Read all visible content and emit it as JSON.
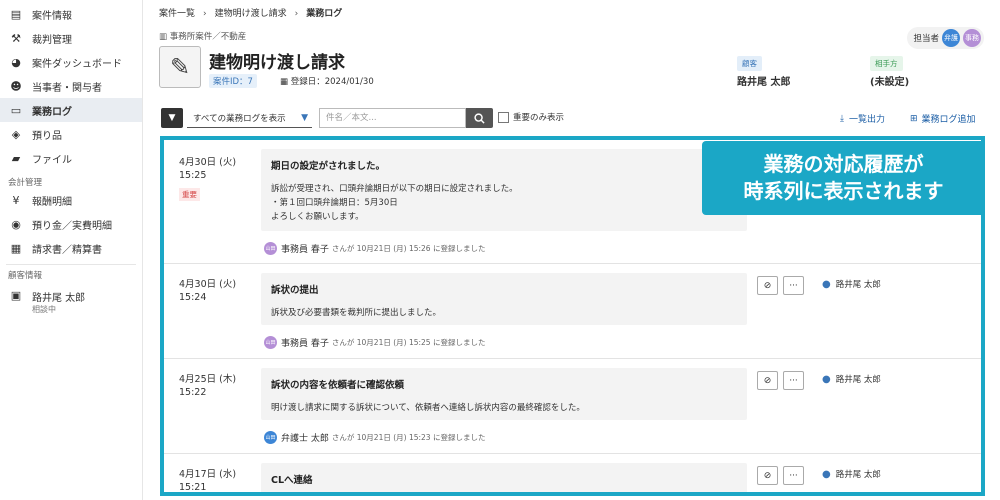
{
  "sidebar": {
    "items": [
      {
        "label": "案件情報",
        "icon": "document-icon"
      },
      {
        "label": "裁判管理",
        "icon": "gavel-icon"
      },
      {
        "label": "案件ダッシュボード",
        "icon": "dashboard-icon"
      },
      {
        "label": "当事者・関与者",
        "icon": "people-icon"
      },
      {
        "label": "業務ログ",
        "icon": "log-icon",
        "active": true
      },
      {
        "label": "預り品",
        "icon": "box-icon"
      },
      {
        "label": "ファイル",
        "icon": "folder-icon"
      }
    ],
    "section_accounting": "会計管理",
    "accounting_items": [
      {
        "label": "報酬明細",
        "icon": "yen-icon"
      },
      {
        "label": "預り金／実費明細",
        "icon": "coins-icon"
      },
      {
        "label": "請求書／精算書",
        "icon": "invoice-icon"
      }
    ],
    "section_client": "顧客情報",
    "client": {
      "name": "路井尾 太郎",
      "status": "相談中"
    }
  },
  "breadcrumb": {
    "items": [
      "案件一覧",
      "建物明け渡し請求"
    ],
    "current": "業務ログ"
  },
  "case": {
    "category": "事務所案件／不動産",
    "title": "建物明け渡し請求",
    "id_label": "案件ID：7",
    "registered": "登録日：2024/01/30",
    "assignee_label": "担当者",
    "assignee_avatars": [
      "弁護",
      "事務"
    ],
    "client_label": "顧客",
    "client_value": "路井尾 太郎",
    "opponent_label": "相手方",
    "opponent_value": "(未設定)"
  },
  "toolbar": {
    "filter_value": "すべての業務ログを表示",
    "search_placeholder": "件名／本文...",
    "important_only": "重要のみ表示",
    "export_label": "一覧出力",
    "add_label": "業務ログ追加"
  },
  "logs": [
    {
      "date": "4月30日 (火)",
      "time": "15:25",
      "badge": "重要",
      "title": "期日の設定がされました。",
      "lines": [
        "訴訟が受理され、口頭弁論期日が以下の期日に設定されました。",
        "・第１回口頭弁論期日：5月30日",
        "よろしくお願いします。"
      ],
      "by": "事務員 春子",
      "by_avatar": "山田",
      "suffix": "さんが 10月21日 (月) 15:26 に登録しました",
      "person": ""
    },
    {
      "date": "4月30日 (火)",
      "time": "15:24",
      "title": "訴状の提出",
      "lines": [
        "訴状及び必要書類を裁判所に提出しました。"
      ],
      "by": "事務員 春子",
      "by_avatar": "山田",
      "suffix": "さんが 10月21日 (月) 15:25 に登録しました",
      "person": "路井尾 太郎"
    },
    {
      "date": "4月25日 (木)",
      "time": "15:22",
      "title": "訴状の内容を依頼者に確認依頼",
      "lines": [
        "明け渡し請求に関する訴状について、依頼者へ連絡し訴状内容の最終確認をした。"
      ],
      "by": "弁護士 太郎",
      "by_avatar": "山田",
      "suffix": "さんが 10月21日 (月) 15:23 に登録しました",
      "person": "路井尾 太郎"
    },
    {
      "date": "4月17日 (水)",
      "time": "15:21",
      "title": "CLへ連絡",
      "lines": [
        ""
      ],
      "by": "",
      "suffix": "",
      "person": "路井尾 太郎"
    }
  ],
  "callout": {
    "line1": "業務の対応履歴が",
    "line2": "時系列に表示されます"
  },
  "colors": {
    "accent": "#1ba7c6",
    "link": "#1d5fa6",
    "important": "#d54a4a"
  }
}
